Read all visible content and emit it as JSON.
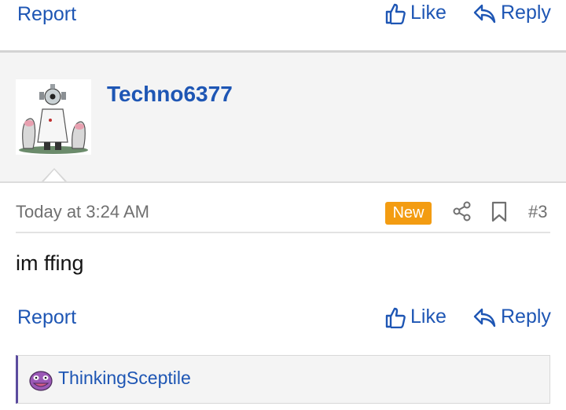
{
  "prev_post": {
    "report_label": "Report",
    "like_label": "Like",
    "reply_label": "Reply"
  },
  "post": {
    "username": "Techno6377",
    "timestamp": "Today at 3:24 AM",
    "new_badge": "New",
    "post_number": "#3",
    "body": "im ffing",
    "report_label": "Report",
    "like_label": "Like",
    "reply_label": "Reply",
    "reaction_user": "ThinkingSceptile",
    "icons": [
      "like-icon",
      "reply-icon",
      "share-icon",
      "bookmark-icon"
    ]
  },
  "colors": {
    "link": "#1e56b4",
    "badge": "#f39c12",
    "band": "#f4f4f4",
    "reaction_accent": "#5b4b9e"
  }
}
